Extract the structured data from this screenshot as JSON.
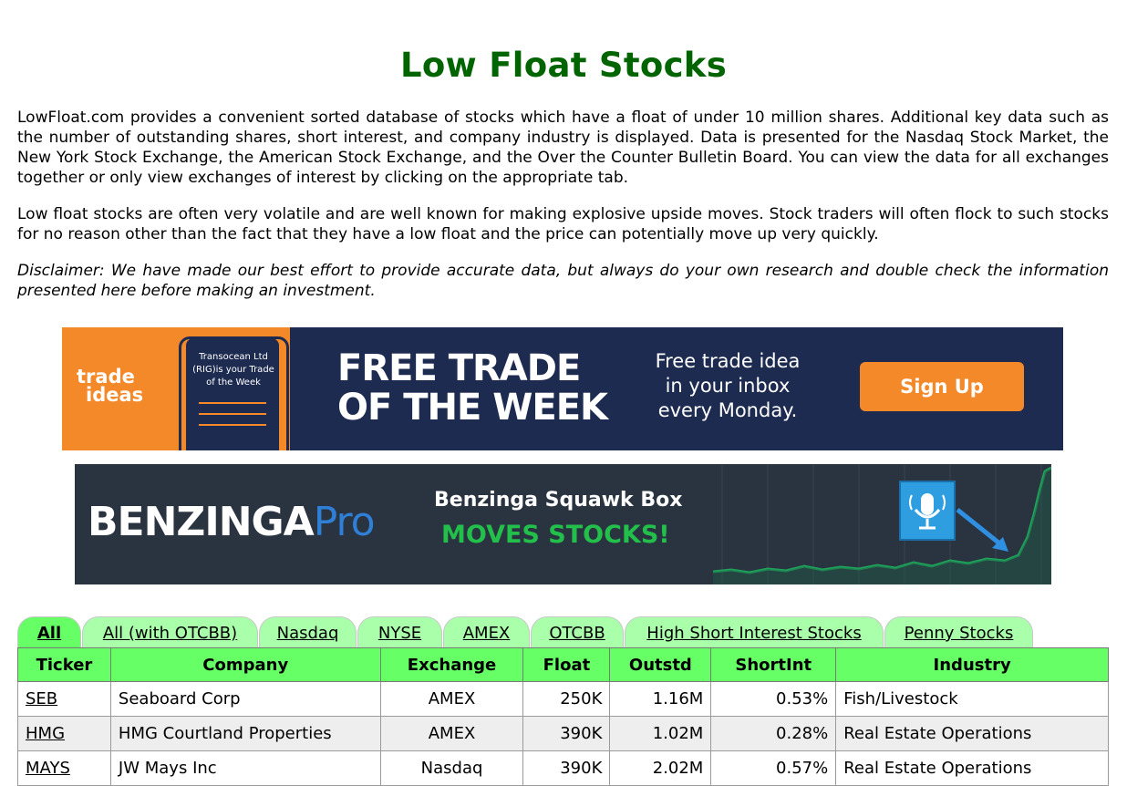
{
  "header": {
    "title": "Low Float Stocks"
  },
  "intro": {
    "p1": "LowFloat.com provides a convenient sorted database of stocks which have a float of under 10 million shares. Additional key data such as the number of outstanding shares, short interest, and company industry is displayed. Data is presented for the Nasdaq Stock Market, the New York Stock Exchange, the American Stock Exchange, and the Over the Counter Bulletin Board. You can view the data for all exchanges together or only view exchanges of interest by clicking on the appropriate tab.",
    "p2": "Low float stocks are often very volatile and are well known for making explosive upside moves. Stock traders will often flock to such stocks for no reason other than the fact that they have a low float and the price can potentially move up very quickly.",
    "disclaimer": "Disclaimer: We have made our best effort to provide accurate data, but always do your own research and double check the information presented here before making an investment."
  },
  "ad_trade_ideas": {
    "logo_line1": "trade",
    "logo_line2": "ideas",
    "phone_text": "Transocean Ltd (RIG)is your Trade of the Week",
    "headline_line1": "FREE TRADE",
    "headline_line2": "OF THE WEEK",
    "sub_line1": "Free trade idea",
    "sub_line2": "in your inbox",
    "sub_line3": "every Monday.",
    "button": "Sign Up"
  },
  "ad_benzinga": {
    "logo": "BENZINGA",
    "logo_pro": "Pro",
    "line1": "Benzinga Squawk Box",
    "line2": "MOVES STOCKS!"
  },
  "tabs": [
    "All",
    "All (with OTCBB)",
    "Nasdaq",
    "NYSE",
    "AMEX",
    "OTCBB",
    "High Short Interest Stocks",
    "Penny Stocks"
  ],
  "table": {
    "headers": [
      "Ticker",
      "Company",
      "Exchange",
      "Float",
      "Outstd",
      "ShortInt",
      "Industry"
    ],
    "rows": [
      {
        "ticker": "SEB",
        "company": "Seaboard Corp",
        "exchange": "AMEX",
        "float": "250K",
        "outstd": "1.16M",
        "shortint": "0.53%",
        "industry": "Fish/Livestock"
      },
      {
        "ticker": "HMG",
        "company": "HMG Courtland Properties",
        "exchange": "AMEX",
        "float": "390K",
        "outstd": "1.02M",
        "shortint": "0.28%",
        "industry": "Real Estate Operations"
      },
      {
        "ticker": "MAYS",
        "company": "JW Mays Inc",
        "exchange": "Nasdaq",
        "float": "390K",
        "outstd": "2.02M",
        "shortint": "0.57%",
        "industry": "Real Estate Operations"
      }
    ]
  },
  "colors": {
    "title": "#006400",
    "tab_active": "#66ff66",
    "tab_inactive": "#aaffaa",
    "table_header": "#66ff66"
  }
}
